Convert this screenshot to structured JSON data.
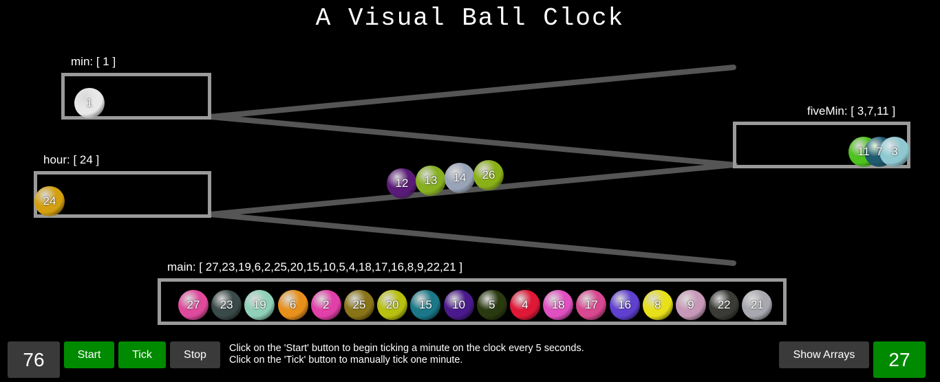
{
  "title": "A Visual Ball Clock",
  "labels": {
    "min": "min: [ 1 ]",
    "five_min": "fiveMin: [ 3,7,11 ]",
    "hour": "hour: [ 24 ]",
    "main": "main: [ 27,23,19,6,2,25,20,15,10,5,4,18,17,16,8,9,22,21 ]"
  },
  "min_balls": [
    {
      "label": "1",
      "color": "#e8e8e8"
    }
  ],
  "five_min_balls": [
    {
      "label": "11",
      "color": "#4ec21e"
    },
    {
      "label": "7",
      "color": "#1e5a70"
    },
    {
      "label": "3",
      "color": "#8fc8d0"
    }
  ],
  "hour_balls": [
    {
      "label": "24",
      "color": "#d4a010"
    }
  ],
  "rolling_balls": [
    {
      "label": "12",
      "color": "#5a1b78"
    },
    {
      "label": "13",
      "color": "#86b020"
    },
    {
      "label": "14",
      "color": "#9aa4b8"
    },
    {
      "label": "26",
      "color": "#8ab018"
    }
  ],
  "main_balls": [
    {
      "label": "27",
      "color": "#e04a9c"
    },
    {
      "label": "23",
      "color": "#3a4a48"
    },
    {
      "label": "19",
      "color": "#8fd0b8"
    },
    {
      "label": "6",
      "color": "#e8901c"
    },
    {
      "label": "2",
      "color": "#e040a8"
    },
    {
      "label": "25",
      "color": "#8a7418"
    },
    {
      "label": "20",
      "color": "#b8c010"
    },
    {
      "label": "15",
      "color": "#1a7888"
    },
    {
      "label": "10",
      "color": "#4a1a8c"
    },
    {
      "label": "5",
      "color": "#2a3a10"
    },
    {
      "label": "4",
      "color": "#e01838"
    },
    {
      "label": "18",
      "color": "#e050c0"
    },
    {
      "label": "17",
      "color": "#d84890"
    },
    {
      "label": "16",
      "color": "#6040d0"
    },
    {
      "label": "8",
      "color": "#e8e018"
    },
    {
      "label": "9",
      "color": "#c898b8"
    },
    {
      "label": "22",
      "color": "#3a3a36"
    },
    {
      "label": "21",
      "color": "#a8a8b0"
    }
  ],
  "controls": {
    "tick_count": "76",
    "start": "Start",
    "tick": "Tick",
    "stop": "Stop",
    "show_arrays": "Show Arrays",
    "ball_count": "27"
  },
  "help": {
    "line1": "Click on the 'Start' button to begin ticking a minute on the clock every 5 seconds.",
    "line2": "Click on the 'Tick' button to manually tick one minute."
  },
  "colors": {
    "rail": "#555555",
    "box_border": "#9a9a9a",
    "green_button": "#008a00",
    "gray_button": "#3a3a3a"
  }
}
